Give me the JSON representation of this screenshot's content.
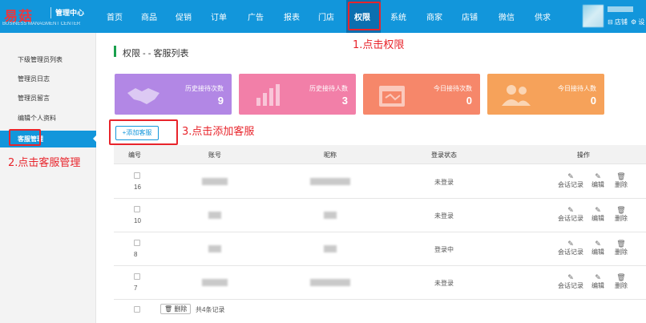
{
  "header": {
    "logo_text": "易菇",
    "logo_subtitle": "管理中心",
    "logo_english": "BUSINESS MANAGMENT CENTER",
    "nav": [
      "首页",
      "商品",
      "促销",
      "订单",
      "广告",
      "报表",
      "门店",
      "权限",
      "系统",
      "商家",
      "店铺",
      "微信",
      "供求"
    ],
    "active_nav": "权限",
    "store_link": "⊟ 店铺",
    "settings_link": "⚙ 设"
  },
  "sidebar": {
    "items": [
      "下级管理员列表",
      "管理员日志",
      "管理员留言",
      "编辑个人资料",
      "客服管理"
    ],
    "active": "客服管理"
  },
  "annotations": {
    "step1": "1.点击权限",
    "step2": "2.点击客服管理",
    "step3": "3.点击添加客服"
  },
  "main": {
    "title": "权限 - - 客服列表",
    "add_button": "+添加客服"
  },
  "stats": [
    {
      "label": "历史接待次数",
      "value": "9",
      "color": "#b287e5",
      "icon": "handshake-icon"
    },
    {
      "label": "历史接待人数",
      "value": "3",
      "color": "#f27fa8",
      "icon": "bar-chart-icon"
    },
    {
      "label": "今日接待次数",
      "value": "0",
      "color": "#f6876a",
      "icon": "calendar-icon"
    },
    {
      "label": "今日接待人数",
      "value": "0",
      "color": "#f6a25a",
      "icon": "users-icon"
    }
  ],
  "table": {
    "headers": [
      "编号",
      "账号",
      "昵称",
      "登录状态",
      "操作"
    ],
    "actions": [
      "会话记录",
      "编辑",
      "删除"
    ],
    "rows": [
      {
        "id": "16",
        "status": "未登录"
      },
      {
        "id": "10",
        "status": "未登录"
      },
      {
        "id": "8",
        "status": "登录中"
      },
      {
        "id": "7",
        "status": "未登录"
      }
    ],
    "delete_button": "🗑 删除",
    "total_text": "共4条记录"
  },
  "colors": {
    "primary": "#1296db",
    "annotation": "#e8242b",
    "title_accent": "#1aa04d"
  }
}
